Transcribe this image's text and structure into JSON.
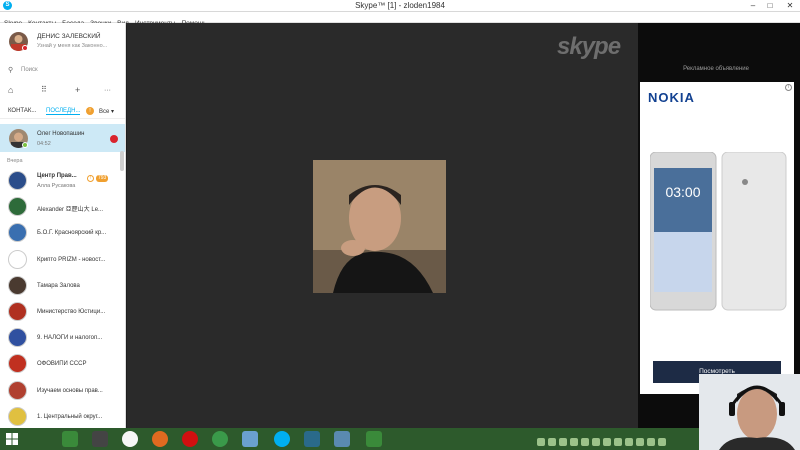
{
  "window": {
    "title": "Skype™ [1] - zloden1984",
    "minimize": "–",
    "maximize": "□",
    "close": "✕"
  },
  "menu": [
    "Skype",
    "Контакты",
    "Беседа",
    "Звонки",
    "Вид",
    "Инструменты",
    "Помощь"
  ],
  "profile": {
    "name": "ДЕНИС ЗАЛЕВСКИЙ",
    "mood": "Узнай у меня как Законно..."
  },
  "search": {
    "placeholder": "Поиск",
    "icon": "search-icon"
  },
  "toolbar": {
    "home_icon": "home-icon",
    "dialpad_icon": "dialpad-icon",
    "add_icon": "plus-icon",
    "more": "···"
  },
  "tabs": {
    "contacts": "КОНТАК...",
    "recent": "ПОСЛЕДН...",
    "recent_badge": "!",
    "filter": "Все"
  },
  "active_chat": {
    "name": "Олег Новопашин",
    "time": "04:52"
  },
  "section_label": "Вчера",
  "contacts": [
    {
      "name": "Центр Прав...",
      "sub": "Алла Русакова",
      "badge": "793",
      "warn": "!",
      "color": "#2b4d8a"
    },
    {
      "name": "Alexander 亞歷山大 Le...",
      "sub": "",
      "color": "#2e6b3a"
    },
    {
      "name": "Б.О.Г. Красноярский кр...",
      "sub": "",
      "color": "#3a6fb0"
    },
    {
      "name": "Крипто PRIZM - новост...",
      "sub": "",
      "color": "#ffffff"
    },
    {
      "name": "Тамара Залова",
      "sub": "",
      "color": "#4a3a30"
    },
    {
      "name": "Министерство Юстици...",
      "sub": "",
      "color": "#b03020"
    },
    {
      "name": "9. НАЛОГИ и налогоп...",
      "sub": "",
      "color": "#3050a0"
    },
    {
      "name": "ОФОВИПИ СССР",
      "sub": "",
      "color": "#c03020"
    },
    {
      "name": "Изучаем основы прав...",
      "sub": "",
      "color": "#b04030"
    },
    {
      "name": "1. Центральный округ...",
      "sub": "",
      "color": "#e0c040"
    }
  ],
  "main": {
    "logo": "skype"
  },
  "ad": {
    "label": "Рекламное объявление",
    "brand": "NOKIA",
    "info": "i",
    "phone_time": "03:00",
    "cta": "Посмотреть"
  },
  "colors": {
    "skype_blue": "#00aff0",
    "active_row": "#cde9f6",
    "main_bg": "#2a2a2a",
    "taskbar": "#2d5a2c"
  }
}
